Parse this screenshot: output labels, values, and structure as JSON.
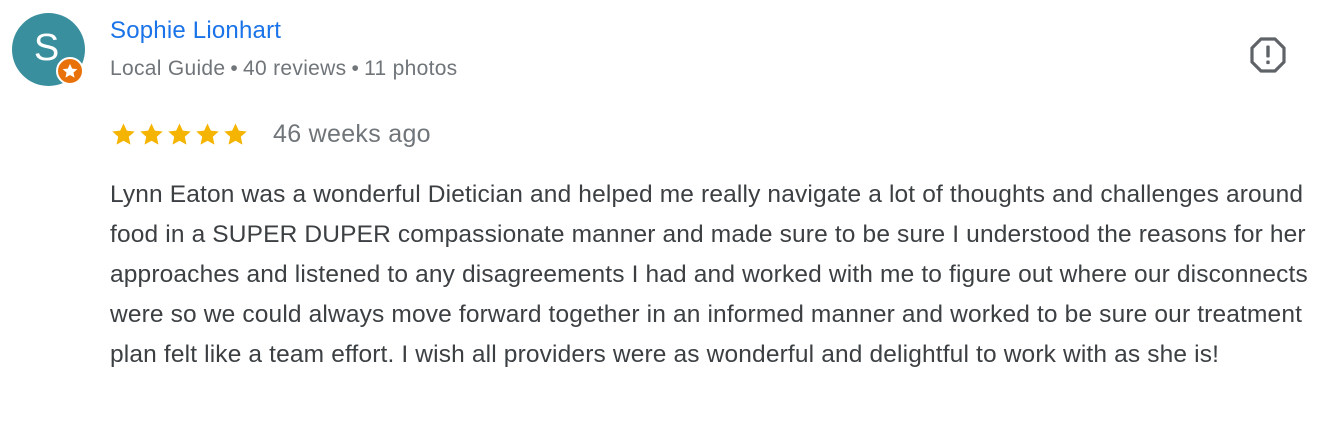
{
  "reviewer": {
    "avatar_letter": "S",
    "avatar_color": "#3a8f9e",
    "badge_icon": "local-guide-star-icon",
    "badge_color": "#e8710a",
    "name": "Sophie Lionhart",
    "level": "Local Guide",
    "reviews": "40 reviews",
    "photos": "11 photos",
    "separator": "•"
  },
  "report_icon": "report-octagon-icon",
  "rating": {
    "stars": 5,
    "max": 5,
    "star_color": "#f4b400"
  },
  "time_ago": "46 weeks ago",
  "text": "Lynn Eaton was a wonderful Dietician and helped me really navigate a lot of thoughts and challenges around food in a SUPER DUPER compassionate manner and made sure to be sure I understood the reasons for her approaches and listened to any disagreements I had and worked with me to figure out where our disconnects were so we could always move forward together in an informed manner and worked to be sure our treatment plan felt like a team effort. I wish all providers were as wonderful and delightful to work with as she is!"
}
